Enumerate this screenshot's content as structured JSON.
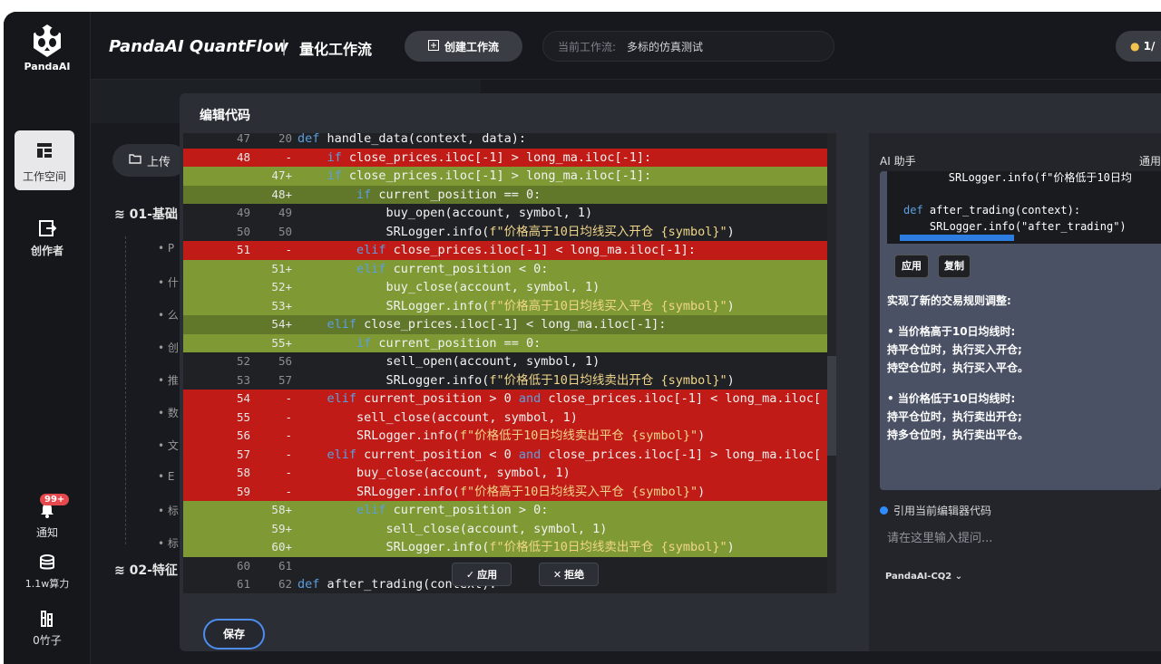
{
  "sidebar": {
    "logo_text": "PandaAI",
    "items": [
      {
        "label": "工作空间",
        "icon": "workspace-icon"
      },
      {
        "label": "创作者",
        "icon": "creator-icon"
      },
      {
        "label": "通知",
        "icon": "bell-icon",
        "badge": "99+"
      },
      {
        "label": "1.1w算力",
        "icon": "database-icon"
      },
      {
        "label": "0竹子",
        "icon": "bamboo-icon"
      }
    ]
  },
  "header": {
    "brand": "PandaAI QuantFlow",
    "separator": "|",
    "subtitle": "量化工作流",
    "create_button": "创建工作流",
    "workflow_label": "当前工作流:",
    "workflow_value": "多标的仿真测试",
    "credits": "1/"
  },
  "workspace": {
    "upload_button": "上传",
    "tree": [
      {
        "label": "01-基础"
      },
      {
        "label": "02-特征"
      }
    ]
  },
  "dialog": {
    "title": "编辑代码",
    "save_button": "保存",
    "apply_button": "应用",
    "reject_button": "拒绝",
    "lines": [
      {
        "a": "47",
        "b": "20",
        "t": "ctx",
        "code": "def handle_data(context, data):"
      },
      {
        "a": "48",
        "b": "-",
        "t": "del",
        "code": "    if close_prices.iloc[-1] > long_ma.iloc[-1]:"
      },
      {
        "a": "",
        "b": "47+",
        "t": "add",
        "code": "    if close_prices.iloc[-1] > long_ma.iloc[-1]:"
      },
      {
        "a": "",
        "b": "48+",
        "t": "add-dark",
        "code": "        if current_position == 0:"
      },
      {
        "a": "49",
        "b": "49",
        "t": "ctx",
        "code": "            buy_open(account, symbol, 1)"
      },
      {
        "a": "50",
        "b": "50",
        "t": "ctx",
        "code": "            SRLogger.info(f\"价格高于10日均线买入开仓 {symbol}\")"
      },
      {
        "a": "51",
        "b": "-",
        "t": "del",
        "code": "        elif close_prices.iloc[-1] < long_ma.iloc[-1]:"
      },
      {
        "a": "",
        "b": "51+",
        "t": "add",
        "code": "        elif current_position < 0:"
      },
      {
        "a": "",
        "b": "52+",
        "t": "add",
        "code": "            buy_close(account, symbol, 1)"
      },
      {
        "a": "",
        "b": "53+",
        "t": "add",
        "code": "            SRLogger.info(f\"价格高于10日均线买入平仓 {symbol}\")"
      },
      {
        "a": "",
        "b": "54+",
        "t": "add-dark",
        "code": "    elif close_prices.iloc[-1] < long_ma.iloc[-1]:"
      },
      {
        "a": "",
        "b": "55+",
        "t": "add",
        "code": "        if current_position == 0:"
      },
      {
        "a": "52",
        "b": "56",
        "t": "ctx",
        "code": "            sell_open(account, symbol, 1)"
      },
      {
        "a": "53",
        "b": "57",
        "t": "ctx",
        "code": "            SRLogger.info(f\"价格低于10日均线卖出开仓 {symbol}\")"
      },
      {
        "a": "54",
        "b": "-",
        "t": "del",
        "code": "    elif current_position > 0 and close_prices.iloc[-1] < long_ma.iloc["
      },
      {
        "a": "55",
        "b": "-",
        "t": "del",
        "code": "        sell_close(account, symbol, 1)"
      },
      {
        "a": "56",
        "b": "-",
        "t": "del",
        "code": "        SRLogger.info(f\"价格低于10日均线卖出平仓 {symbol}\")"
      },
      {
        "a": "57",
        "b": "-",
        "t": "del",
        "code": "    elif current_position < 0 and close_prices.iloc[-1] > long_ma.iloc["
      },
      {
        "a": "58",
        "b": "-",
        "t": "del",
        "code": "        buy_close(account, symbol, 1)"
      },
      {
        "a": "59",
        "b": "-",
        "t": "del",
        "code": "        SRLogger.info(f\"价格高于10日均线买入平仓 {symbol}\")"
      },
      {
        "a": "",
        "b": "58+",
        "t": "add",
        "code": "        elif current_position > 0:"
      },
      {
        "a": "",
        "b": "59+",
        "t": "add",
        "code": "            sell_close(account, symbol, 1)"
      },
      {
        "a": "",
        "b": "60+",
        "t": "add",
        "code": "            SRLogger.info(f\"价格低于10日均线卖出平仓 {symbol}\")"
      },
      {
        "a": "60",
        "b": "61",
        "t": "ctx",
        "code": ""
      },
      {
        "a": "61",
        "b": "62",
        "t": "ctx",
        "code": "def after_trading(context):"
      }
    ]
  },
  "ai": {
    "title": "AI 助手",
    "mode": "通用",
    "code_lines": [
      "        SRLogger.info(f\"价格低于10日均",
      "",
      "def after_trading(context):",
      "    SRLogger.info(\"after_trading\")"
    ],
    "apply_chip": "应用",
    "copy_chip": "复制",
    "summary": "实现了新的交易规则调整:",
    "rule1_head": "•  当价格高于10日均线时:",
    "rule1_a": "持平仓位时，执行买入开仓;",
    "rule1_b": "持空仓位时，执行买入平仓。",
    "rule2_head": "•  当价格低于10日均线时:",
    "rule2_a": "持平仓位时，执行卖出开仓;",
    "rule2_b": "持多仓位时，执行卖出平仓。",
    "reference": "引用当前编辑器代码",
    "input_placeholder": "请在这里输入提问...",
    "model": "PandaAI-CQ2"
  },
  "colors": {
    "added": "#7f9a34",
    "deleted": "#c01b16",
    "accent": "#2f8cff"
  }
}
